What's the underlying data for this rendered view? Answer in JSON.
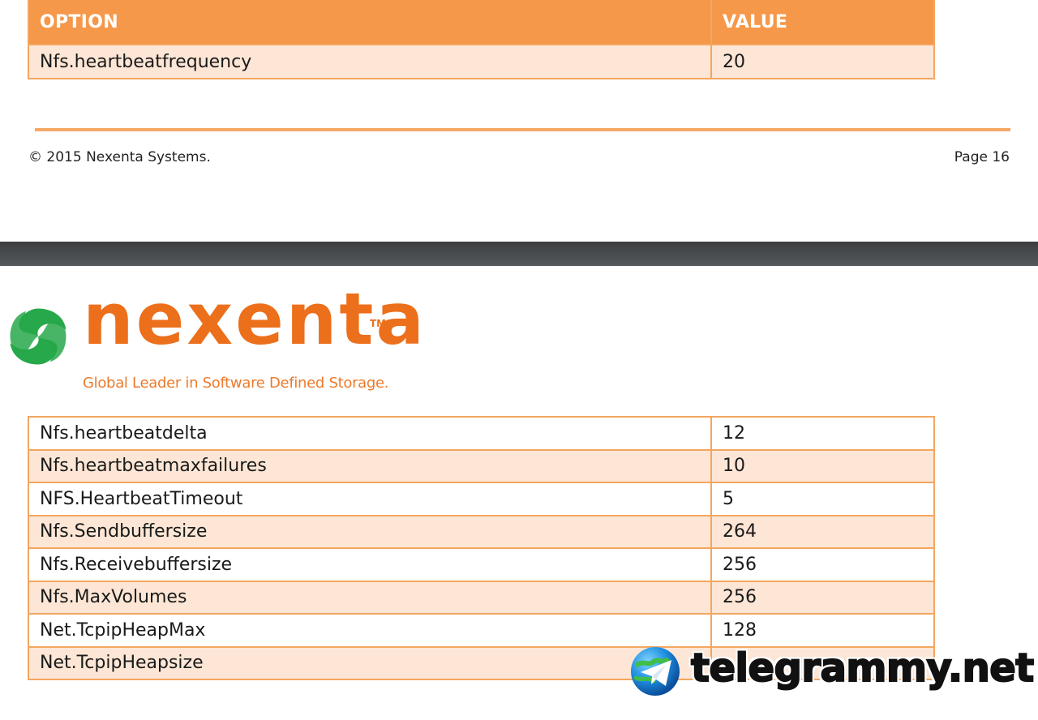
{
  "top_table": {
    "headers": {
      "option": "OPTION",
      "value": "VALUE"
    },
    "rows": [
      {
        "option": "Nfs.heartbeatfrequency",
        "value": "20"
      }
    ]
  },
  "footer": {
    "copyright": "© 2015 Nexenta Systems.",
    "page": "Page 16"
  },
  "logo": {
    "wordmark": "nexenta",
    "trademark": "TM",
    "tagline": "Global Leader in Software Defined Storage.",
    "brand_color": "#ec6f1c",
    "mark_color": "#27a84a"
  },
  "bottom_table": {
    "rows": [
      {
        "option": "Nfs.heartbeatdelta",
        "value": "12"
      },
      {
        "option": "Nfs.heartbeatmaxfailures",
        "value": "10"
      },
      {
        "option": "NFS.HeartbeatTimeout",
        "value": "5"
      },
      {
        "option": "Nfs.Sendbuffersize",
        "value": "264"
      },
      {
        "option": "Nfs.Receivebuffersize",
        "value": "256"
      },
      {
        "option": "Nfs.MaxVolumes",
        "value": "256"
      },
      {
        "option": "Net.TcpipHeapMax",
        "value": "128"
      },
      {
        "option": "Net.TcpipHeapsize",
        "value": ""
      }
    ]
  },
  "watermark": {
    "text": "telegrammy.net",
    "icon": "telegram-globe-icon"
  },
  "colors": {
    "header_bg": "#f5984a",
    "row_tint": "#fde6d5",
    "border": "#f3a661"
  }
}
